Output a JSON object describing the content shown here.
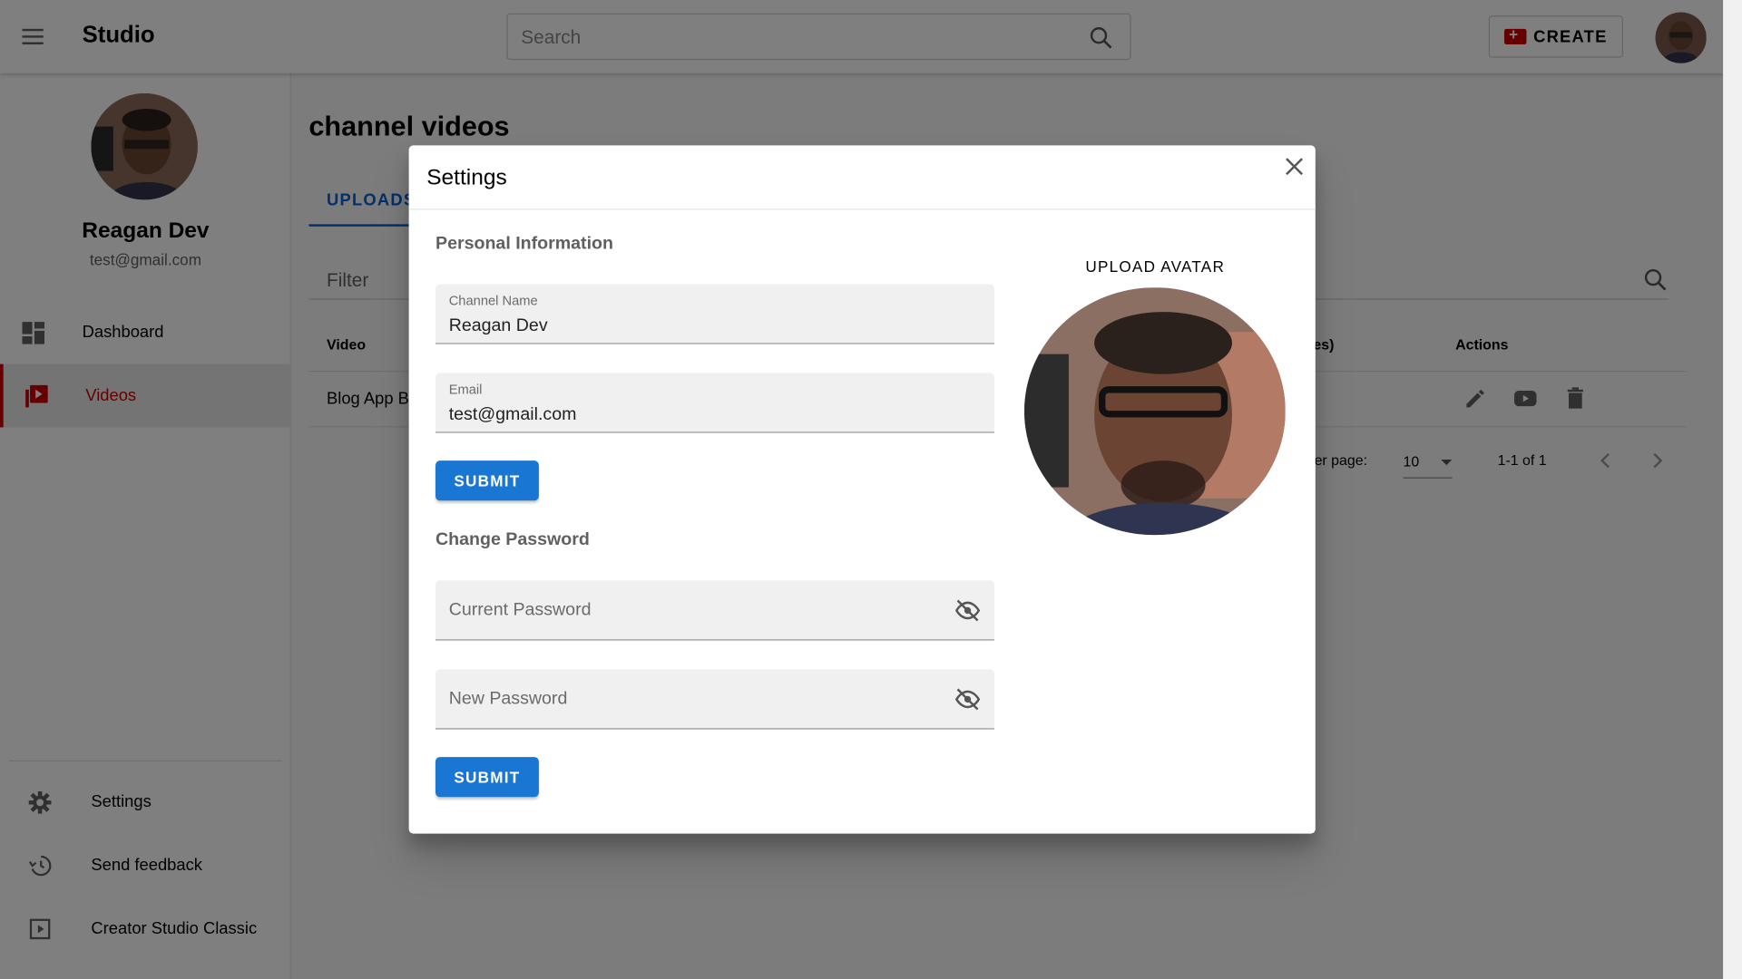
{
  "topbar": {
    "brand": "Studio",
    "search_placeholder": "Search",
    "create_label": "CREATE"
  },
  "sidebar": {
    "user_name": "Reagan Dev",
    "user_email": "test@gmail.com",
    "nav": [
      {
        "label": "Dashboard",
        "icon": "dashboard-icon"
      },
      {
        "label": "Videos",
        "icon": "video-library-icon",
        "active": true
      }
    ],
    "bottom": [
      {
        "label": "Settings",
        "icon": "gear-icon"
      },
      {
        "label": "Send feedback",
        "icon": "history-icon"
      },
      {
        "label": "Creator Studio Classic",
        "icon": "play-square-icon"
      }
    ]
  },
  "main": {
    "title": "channel videos",
    "tab_uploads": "UPLOADS",
    "filter_label": "Filter",
    "table": {
      "col_video": "Video",
      "col_views_partial": "es)",
      "col_actions": "Actions",
      "row_video": "Blog App Bu"
    },
    "pager": {
      "rows_label": "er page:",
      "rows_value": "10",
      "range": "1-1 of 1"
    }
  },
  "dialog": {
    "title": "Settings",
    "personal_title": "Personal Information",
    "channel_name_label": "Channel Name",
    "channel_name_value": "Reagan Dev",
    "email_label": "Email",
    "email_value": "test@gmail.com",
    "submit_label": "SUBMIT",
    "password_title": "Change Password",
    "current_password_placeholder": "Current Password",
    "new_password_placeholder": "New Password",
    "upload_avatar_label": "UPLOAD AVATAR"
  },
  "colors": {
    "accent_blue": "#065fd4",
    "button_blue": "#1976d2",
    "brand_red": "#cc0000"
  }
}
